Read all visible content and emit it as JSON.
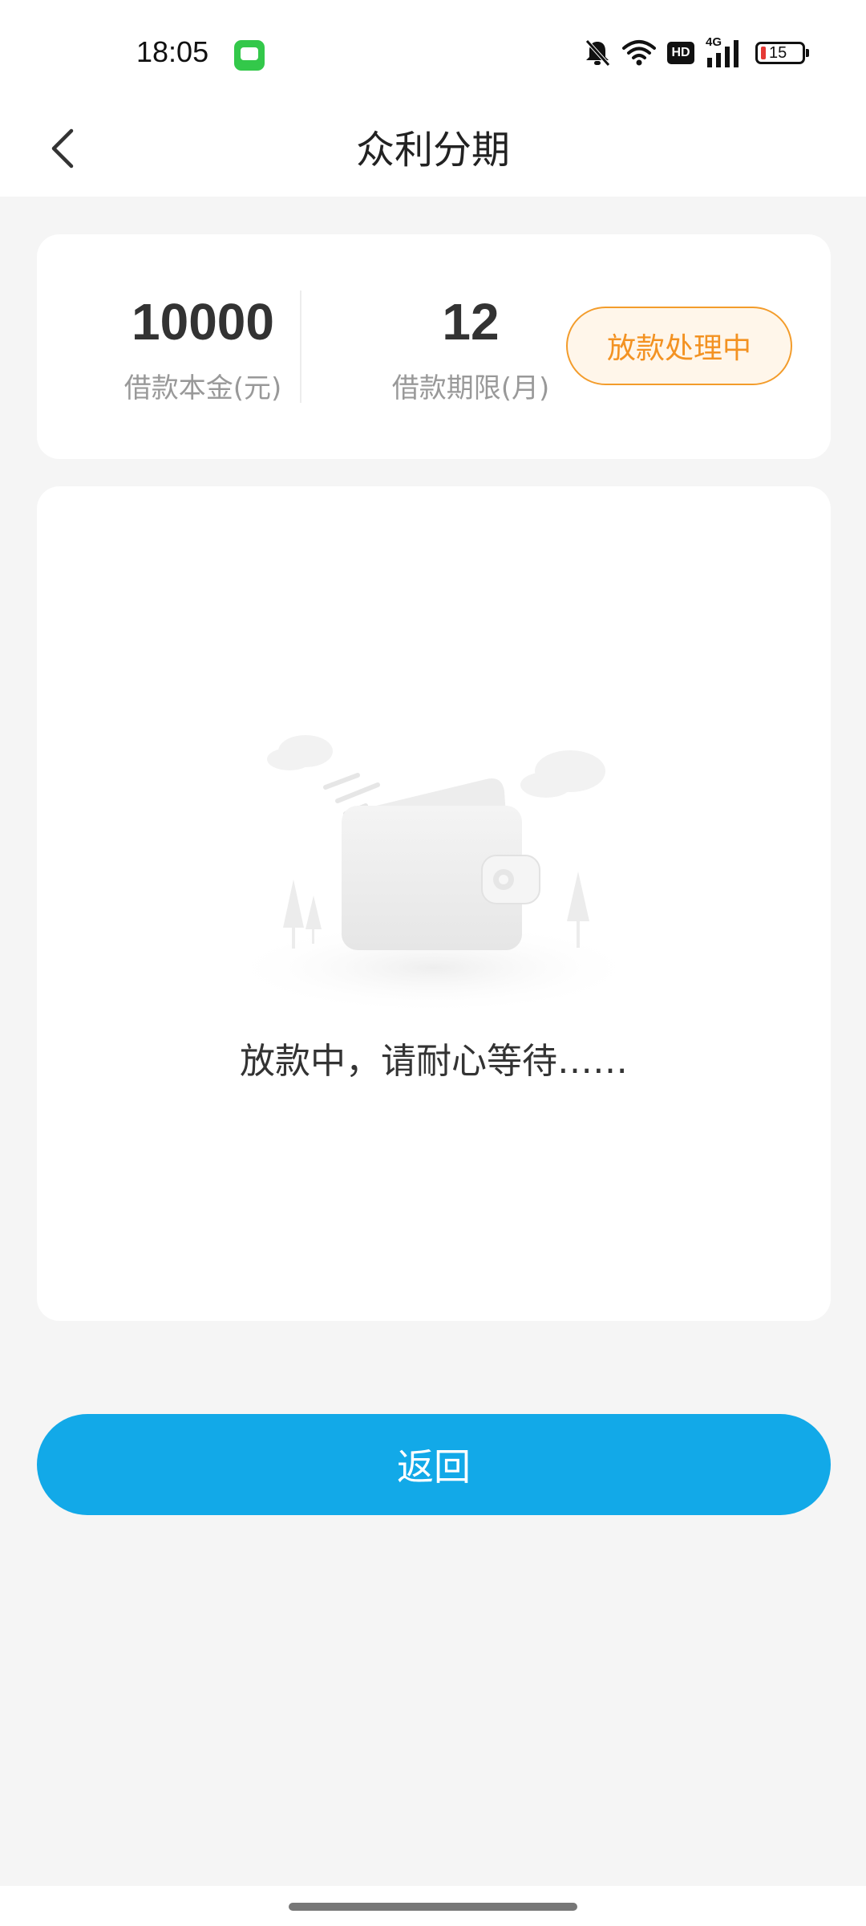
{
  "status_bar": {
    "time": "18:05",
    "network": "4G",
    "hd_badge": "HD",
    "battery_percent": "15",
    "icons": [
      "message-app-icon",
      "bell-muted-icon",
      "wifi-icon",
      "hd-icon",
      "signal-4g-icon",
      "battery-icon"
    ]
  },
  "nav": {
    "title": "众利分期",
    "back_icon": "chevron-left-icon"
  },
  "summary": {
    "principal_value": "10000",
    "principal_label": "借款本金(元)",
    "term_value": "12",
    "term_label": "借款期限(月)",
    "status_label": "放款处理中"
  },
  "main": {
    "illustration": "wallet-illustration",
    "message": "放款中，请耐心等待……"
  },
  "actions": {
    "return_label": "返回"
  },
  "colors": {
    "primary": "#12a9e8",
    "status_orange": "#f39222",
    "background": "#f5f5f5"
  }
}
